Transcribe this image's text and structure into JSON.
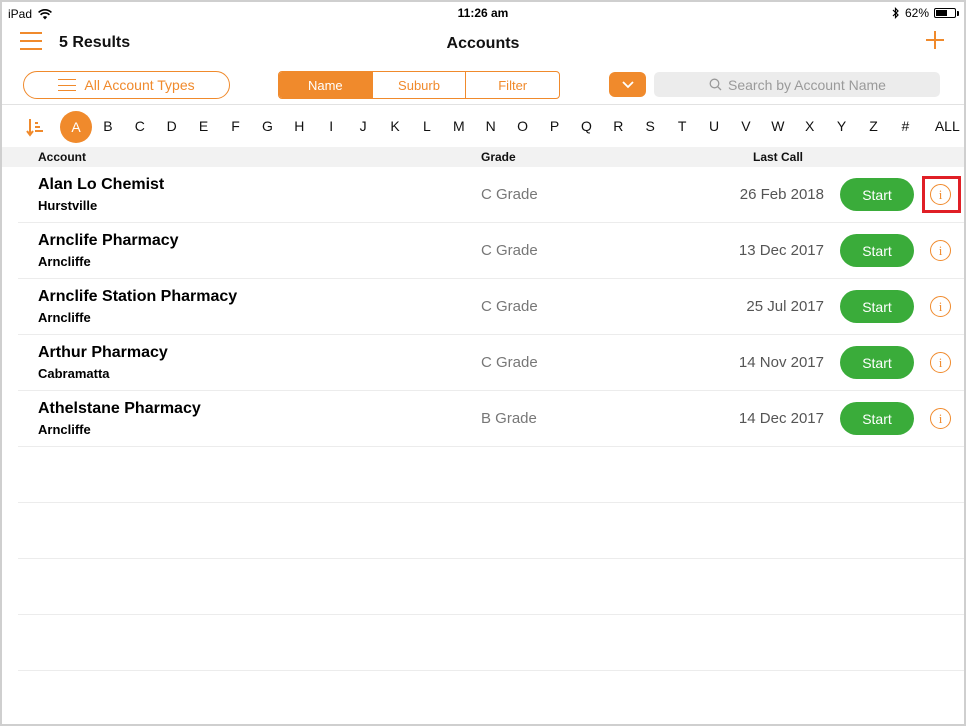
{
  "status": {
    "device": "iPad",
    "time": "11:26 am",
    "battery": "62%",
    "battery_level": 0.62
  },
  "nav": {
    "results": "5 Results",
    "title": "Accounts"
  },
  "toolbar": {
    "account_types": "All Account Types",
    "segments": [
      "Name",
      "Suburb",
      "Filter"
    ],
    "active_segment": "Name",
    "search_placeholder": "Search by Account Name"
  },
  "alphabet": {
    "letters": [
      "A",
      "B",
      "C",
      "D",
      "E",
      "F",
      "G",
      "H",
      "I",
      "J",
      "K",
      "L",
      "M",
      "N",
      "O",
      "P",
      "Q",
      "R",
      "S",
      "T",
      "U",
      "V",
      "W",
      "X",
      "Y",
      "Z",
      "#",
      "ALL"
    ],
    "active": "A"
  },
  "table": {
    "headers": {
      "account": "Account",
      "grade": "Grade",
      "last_call": "Last Call"
    },
    "start_label": "Start",
    "info_glyph": "i",
    "rows": [
      {
        "name": "Alan Lo Chemist",
        "suburb": "Hurstville",
        "grade": "C Grade",
        "last_call": "26 Feb 2018"
      },
      {
        "name": "Arnclife Pharmacy",
        "suburb": "Arncliffe",
        "grade": "C Grade",
        "last_call": "13 Dec 2017"
      },
      {
        "name": "Arnclife Station Pharmacy",
        "suburb": "Arncliffe",
        "grade": "C Grade",
        "last_call": "25 Jul 2017"
      },
      {
        "name": "Arthur Pharmacy",
        "suburb": "Cabramatta",
        "grade": "C Grade",
        "last_call": "14 Nov 2017"
      },
      {
        "name": "Athelstane Pharmacy",
        "suburb": "Arncliffe",
        "grade": "B Grade",
        "last_call": "14 Dec 2017"
      }
    ]
  },
  "colors": {
    "accent": "#f08a2c",
    "start": "#3aac3a",
    "highlight": "#e01f26"
  },
  "icons": [
    "wifi-icon",
    "bluetooth-icon",
    "battery-icon",
    "menu-icon",
    "add-icon",
    "list-icon",
    "chevron-down-icon",
    "search-icon",
    "sort-icon",
    "info-icon"
  ]
}
